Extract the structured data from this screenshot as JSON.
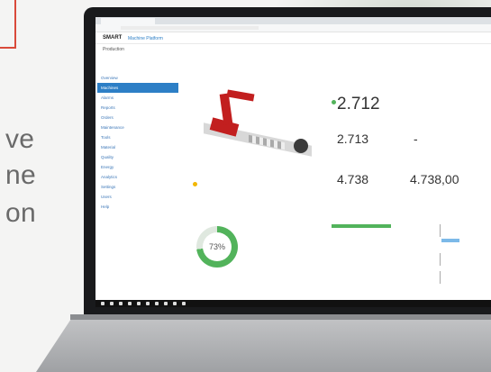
{
  "hero_text": {
    "line1": "ve",
    "line2": "ne",
    "line3": "on"
  },
  "screen": {
    "brand": "SMART",
    "platform": "Machine Platform",
    "breadcrumb": "Production",
    "sidebar_items": [
      "Overview",
      "Machines",
      "Alarms",
      "Reports",
      "Orders",
      "Maintenance",
      "Tools",
      "Material",
      "Quality",
      "Energy",
      "Analytics",
      "Settings",
      "Users",
      "Help"
    ],
    "stats": {
      "value_a": "2.712",
      "value_b": "2.713",
      "value_c": "-",
      "value_d": "4.738",
      "value_e": "4.738,00"
    },
    "donut_percent": "73%",
    "donut_fraction": 0.73
  }
}
